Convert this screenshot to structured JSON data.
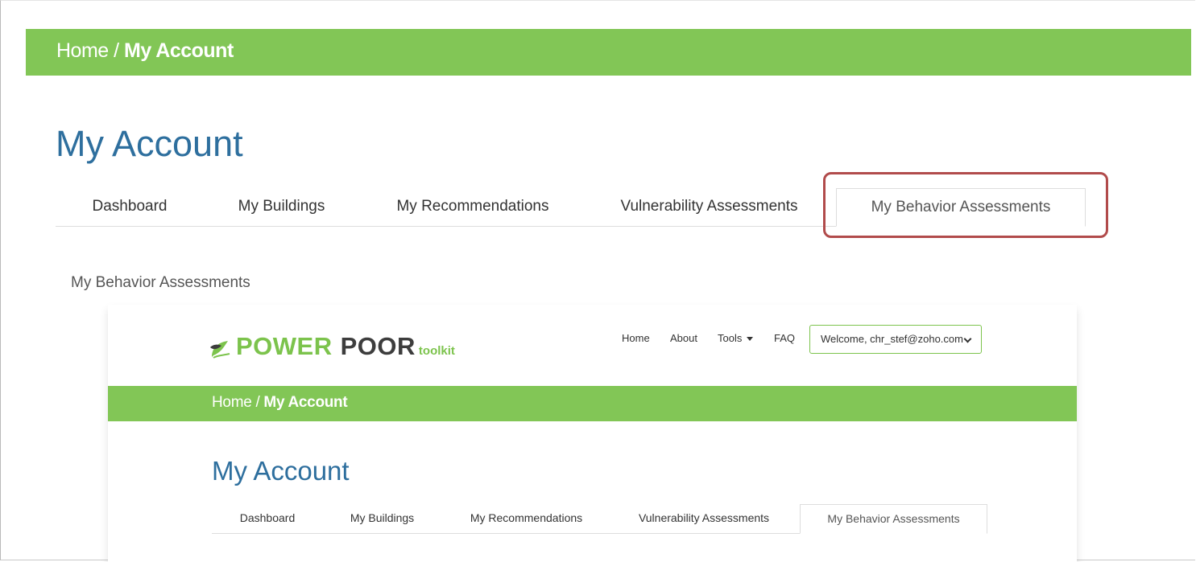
{
  "breadcrumb": {
    "home": "Home",
    "separator": " / ",
    "current": "My Account"
  },
  "page_title": "My Account",
  "tabs": [
    {
      "label": "Dashboard"
    },
    {
      "label": "My Buildings"
    },
    {
      "label": "My Recommendations"
    },
    {
      "label": "Vulnerability Assessments"
    },
    {
      "label": "My Behavior Assessments",
      "active": true
    }
  ],
  "section_label": "My Behavior Assessments",
  "inner": {
    "logo": {
      "power": "POWER",
      "poor": "POOR",
      "toolkit": "toolkit"
    },
    "nav": {
      "home": "Home",
      "about": "About",
      "tools": "Tools",
      "faq": "FAQ"
    },
    "welcome": "Welcome, chr_stef@zoho.com",
    "breadcrumb": {
      "home": "Home",
      "separator": " / ",
      "current": "My Account"
    },
    "page_title": "My Account",
    "tabs": [
      {
        "label": "Dashboard"
      },
      {
        "label": "My Buildings"
      },
      {
        "label": "My Recommendations"
      },
      {
        "label": "Vulnerability Assessments"
      },
      {
        "label": "My Behavior Assessments",
        "active": true
      }
    ]
  },
  "colors": {
    "accent_green": "#82c656",
    "title_blue": "#2e6f9e",
    "highlight_red": "#b14b4b"
  }
}
